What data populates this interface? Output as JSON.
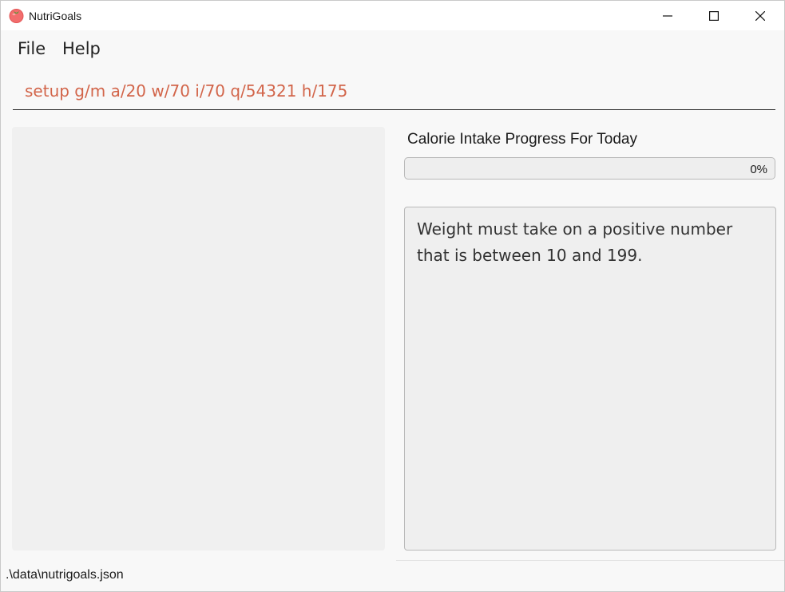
{
  "window": {
    "title": "NutriGoals",
    "controls": {
      "minimize_icon": "minimize-icon",
      "maximize_icon": "maximize-icon",
      "close_icon": "close-icon"
    }
  },
  "menu": {
    "items": [
      {
        "label": "File"
      },
      {
        "label": "Help"
      }
    ]
  },
  "command": {
    "value": "setup g/m a/20 w/70 i/70 q/54321 h/175",
    "error_color": "#d2654a"
  },
  "progress": {
    "title": "Calorie Intake Progress For Today",
    "value": 0,
    "label": "0%"
  },
  "result": {
    "message": "Weight must take on a positive number that is between 10 and 199."
  },
  "status": {
    "file_path": ".\\data\\nutrigoals.json"
  }
}
